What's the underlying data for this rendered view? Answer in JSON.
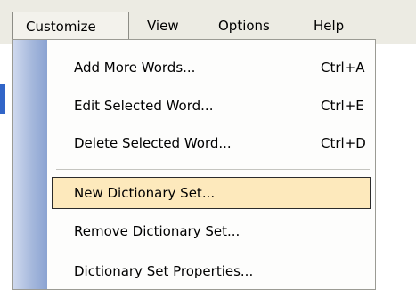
{
  "menubar": {
    "items": [
      "Customize",
      "View",
      "Options",
      "Help"
    ]
  },
  "customize_menu": {
    "items": [
      {
        "label": "Add More Words...",
        "shortcut": "Ctrl+A"
      },
      {
        "label": "Edit Selected Word...",
        "shortcut": "Ctrl+E"
      },
      {
        "label": "Delete Selected Word...",
        "shortcut": "Ctrl+D"
      },
      {
        "label": "New Dictionary Set...",
        "shortcut": ""
      },
      {
        "label": "Remove Dictionary Set...",
        "shortcut": ""
      },
      {
        "label": "Dictionary Set Properties...",
        "shortcut": ""
      }
    ],
    "highlighted_index": 3
  },
  "colors": {
    "menubar_bg": "#ecebe3",
    "highlight_bg": "#fde9bc",
    "gutter": "#a5b8dc"
  }
}
